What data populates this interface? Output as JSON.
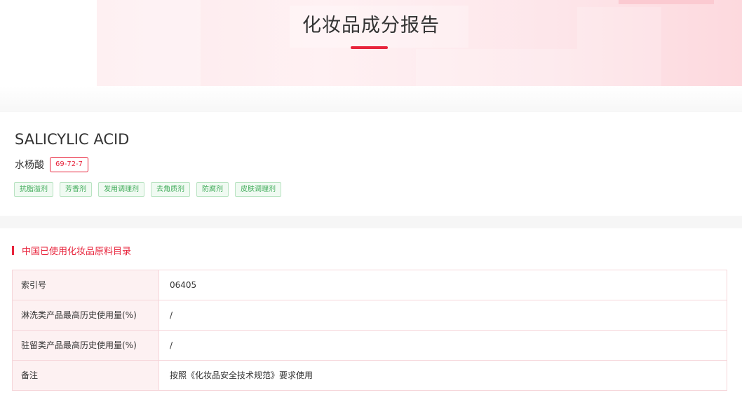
{
  "header": {
    "title": "化妆品成分报告"
  },
  "ingredient": {
    "name_en": "SALICYLIC ACID",
    "name_cn": "水杨酸",
    "cas": "69-72-7",
    "functions": [
      "抗脂溢剂",
      "芳香剂",
      "发用调理剂",
      "去角质剂",
      "防腐剂",
      "皮肤调理剂"
    ]
  },
  "catalog": {
    "title": "中国已使用化妆品原料目录",
    "rows": [
      {
        "key": "索引号",
        "value": "06405"
      },
      {
        "key": "淋洗类产品最高历史使用量(%)",
        "value": "/"
      },
      {
        "key": "驻留类产品最高历史使用量(%)",
        "value": "/"
      },
      {
        "key": "备注",
        "value": "按照《化妆品安全技术规范》要求使用"
      }
    ]
  },
  "colors": {
    "accent": "#e8243c",
    "tag_green": "#3daa57"
  }
}
